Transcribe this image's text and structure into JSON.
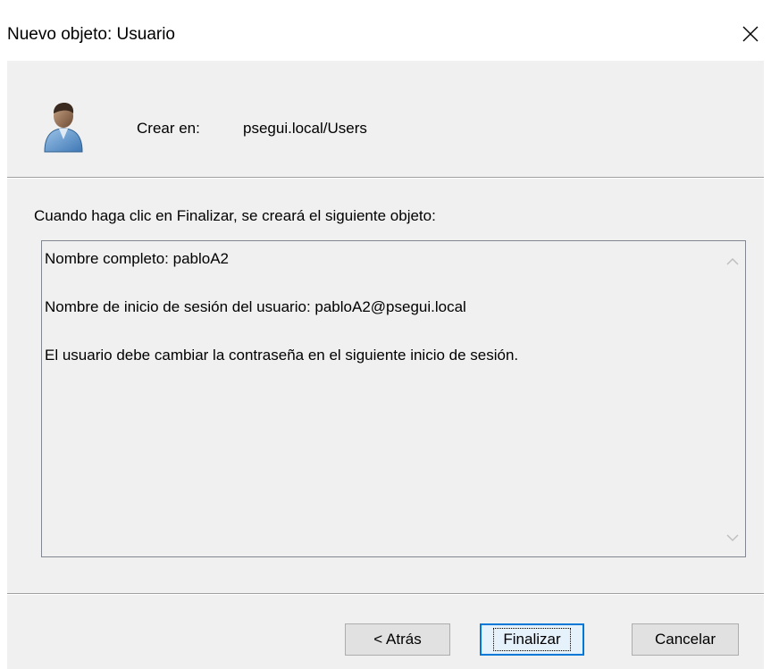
{
  "window": {
    "title": "Nuevo objeto: Usuario",
    "close_glyph": "✕"
  },
  "header": {
    "icon": "user-icon",
    "create_in_label": "Crear en:",
    "create_in_value": "psegui.local/Users"
  },
  "instruction": "Cuando haga clic en Finalizar, se creará el siguiente objeto:",
  "summary": {
    "lines": [
      "Nombre completo: pabloA2",
      "Nombre de inicio de sesión del usuario: pabloA2@psegui.local",
      "El usuario debe cambiar la contraseña en el siguiente inicio de sesión."
    ],
    "scroll_up_icon": "chevron-up-icon",
    "scroll_down_icon": "chevron-down-icon"
  },
  "buttons": {
    "back": "< Atrás",
    "finish": "Finalizar",
    "cancel": "Cancelar"
  },
  "colors": {
    "dialog_background": "#f0f0f0",
    "default_button_border": "#0078d7",
    "default_button_fill": "#e5f1fb"
  }
}
